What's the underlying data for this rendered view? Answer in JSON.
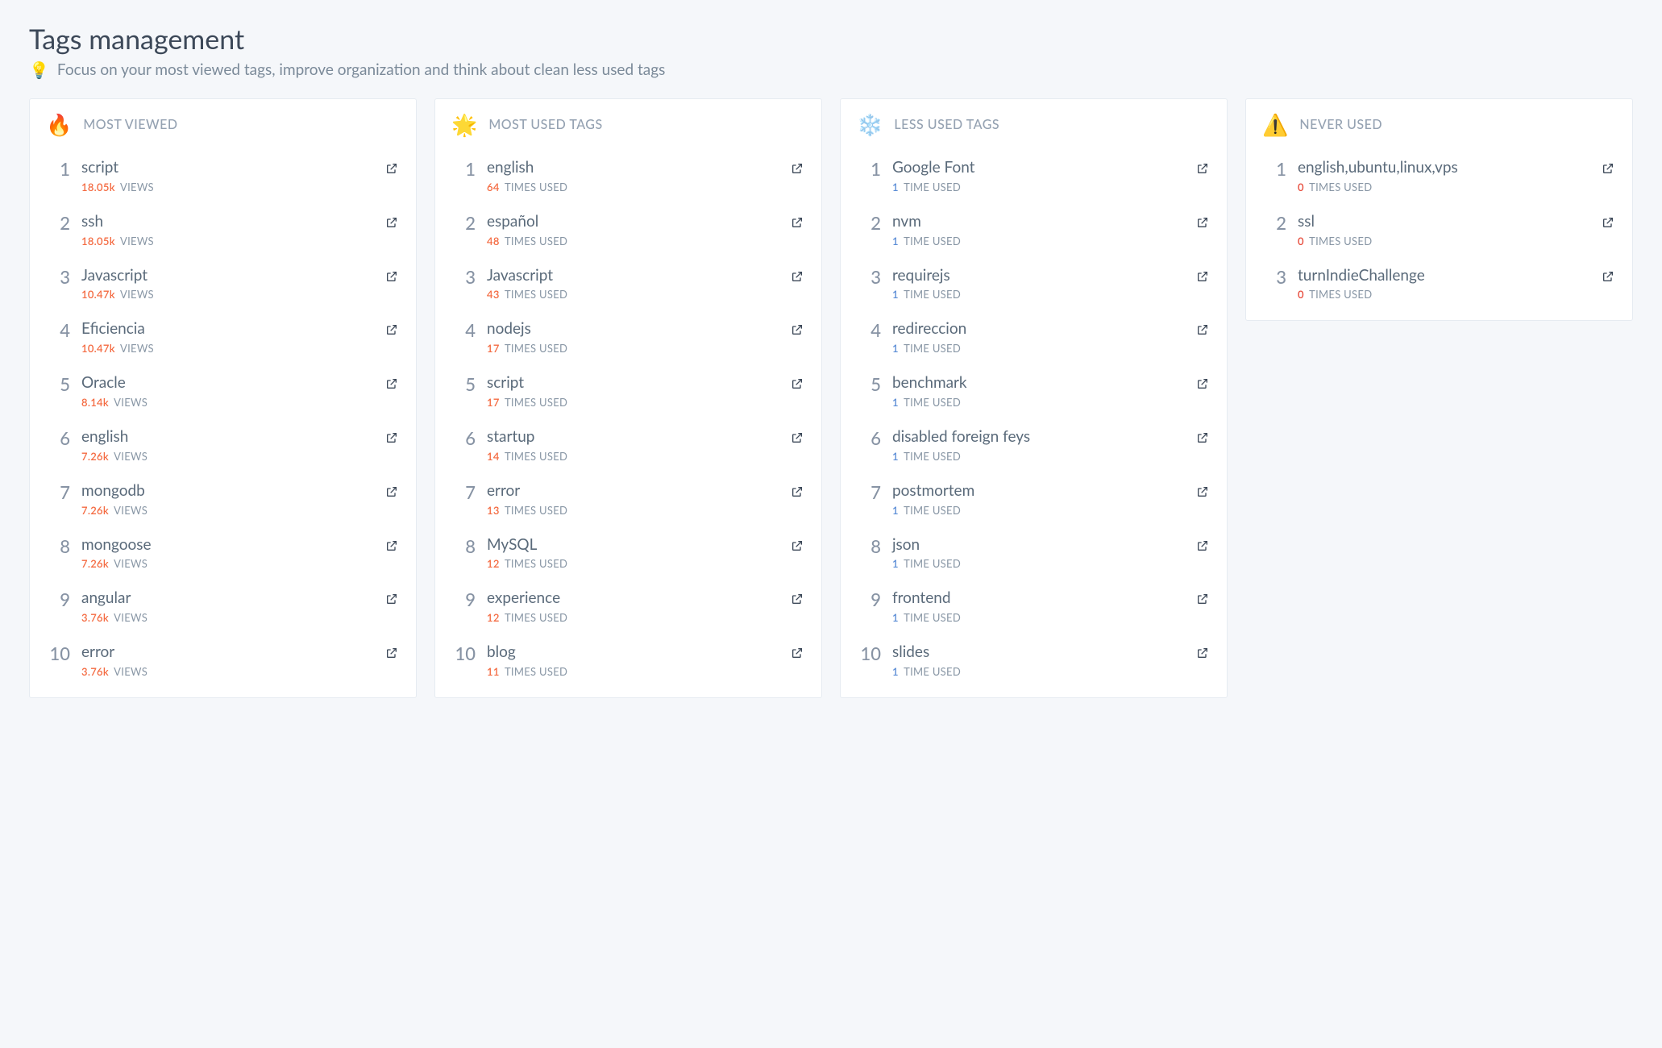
{
  "page": {
    "title": "Tags management",
    "subtitle": "Focus on your most viewed tags, improve organization and think about clean less used tags",
    "bulb_icon": "💡"
  },
  "columns": [
    {
      "id": "most-viewed",
      "icon": "🔥",
      "title": "MOST VIEWED",
      "count_class": "count-orange",
      "suffix": "VIEWS",
      "items": [
        {
          "rank": "1",
          "name": "script",
          "count": "18.05k"
        },
        {
          "rank": "2",
          "name": "ssh",
          "count": "18.05k"
        },
        {
          "rank": "3",
          "name": "Javascript",
          "count": "10.47k"
        },
        {
          "rank": "4",
          "name": "Eficiencia",
          "count": "10.47k"
        },
        {
          "rank": "5",
          "name": "Oracle",
          "count": "8.14k"
        },
        {
          "rank": "6",
          "name": "english",
          "count": "7.26k"
        },
        {
          "rank": "7",
          "name": "mongodb",
          "count": "7.26k"
        },
        {
          "rank": "8",
          "name": "mongoose",
          "count": "7.26k"
        },
        {
          "rank": "9",
          "name": "angular",
          "count": "3.76k"
        },
        {
          "rank": "10",
          "name": "error",
          "count": "3.76k"
        }
      ]
    },
    {
      "id": "most-used",
      "icon": "🌟",
      "title": "MOST USED TAGS",
      "count_class": "count-orange",
      "suffix": "TIMES USED",
      "items": [
        {
          "rank": "1",
          "name": "english",
          "count": "64"
        },
        {
          "rank": "2",
          "name": "español",
          "count": "48"
        },
        {
          "rank": "3",
          "name": "Javascript",
          "count": "43"
        },
        {
          "rank": "4",
          "name": "nodejs",
          "count": "17"
        },
        {
          "rank": "5",
          "name": "script",
          "count": "17"
        },
        {
          "rank": "6",
          "name": "startup",
          "count": "14"
        },
        {
          "rank": "7",
          "name": "error",
          "count": "13"
        },
        {
          "rank": "8",
          "name": "MySQL",
          "count": "12"
        },
        {
          "rank": "9",
          "name": "experience",
          "count": "12"
        },
        {
          "rank": "10",
          "name": "blog",
          "count": "11"
        }
      ]
    },
    {
      "id": "less-used",
      "icon": "❄️",
      "title": "LESS USED TAGS",
      "count_class": "count-blue",
      "suffix": "TIME USED",
      "items": [
        {
          "rank": "1",
          "name": "Google Font",
          "count": "1"
        },
        {
          "rank": "2",
          "name": "nvm",
          "count": "1"
        },
        {
          "rank": "3",
          "name": "requirejs",
          "count": "1"
        },
        {
          "rank": "4",
          "name": "redireccion",
          "count": "1"
        },
        {
          "rank": "5",
          "name": "benchmark",
          "count": "1"
        },
        {
          "rank": "6",
          "name": "disabled foreign feys",
          "count": "1"
        },
        {
          "rank": "7",
          "name": "postmortem",
          "count": "1"
        },
        {
          "rank": "8",
          "name": "json",
          "count": "1"
        },
        {
          "rank": "9",
          "name": "frontend",
          "count": "1"
        },
        {
          "rank": "10",
          "name": "slides",
          "count": "1"
        }
      ]
    },
    {
      "id": "never-used",
      "icon": "⚠️",
      "title": "NEVER USED",
      "count_class": "count-red",
      "suffix": "TIMES USED",
      "items": [
        {
          "rank": "1",
          "name": "english,ubuntu,linux,vps",
          "count": "0"
        },
        {
          "rank": "2",
          "name": "ssl",
          "count": "0"
        },
        {
          "rank": "3",
          "name": "turnIndieChallenge",
          "count": "0"
        }
      ]
    }
  ]
}
